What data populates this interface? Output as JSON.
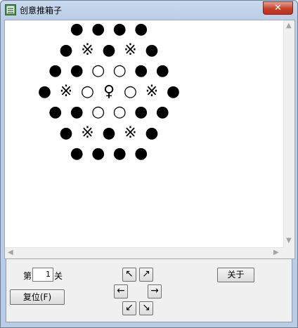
{
  "window": {
    "title": "创意推箱子",
    "close_glyph": "✕"
  },
  "board": {
    "rows": [
      [
        "●",
        "●",
        "●",
        "●"
      ],
      [
        "●",
        "※",
        "●",
        "※",
        "●"
      ],
      [
        "●",
        "●",
        "○",
        "○",
        "●",
        "●"
      ],
      [
        "●",
        "※",
        "○",
        "♀",
        "○",
        "※",
        "●"
      ],
      [
        "●",
        "●",
        "○",
        "○",
        "●",
        "●"
      ],
      [
        "●",
        "※",
        "●",
        "※",
        "●"
      ],
      [
        "●",
        "●",
        "●",
        "●"
      ]
    ],
    "legend": {
      "●": "wall",
      "※": "goal",
      "○": "box",
      "♀": "player"
    }
  },
  "scrollbars": {
    "up": "▲",
    "down": "▼",
    "left": "◀",
    "right": "▶"
  },
  "controls": {
    "level_prefix": "第",
    "level_value": "1",
    "level_suffix": "关",
    "reset_label": "复位(F)",
    "about_label": "关于",
    "dir": {
      "up_left": "↖",
      "up_right": "↗",
      "left": "←",
      "right": "→",
      "down_left": "↙",
      "down_right": "↘"
    }
  }
}
